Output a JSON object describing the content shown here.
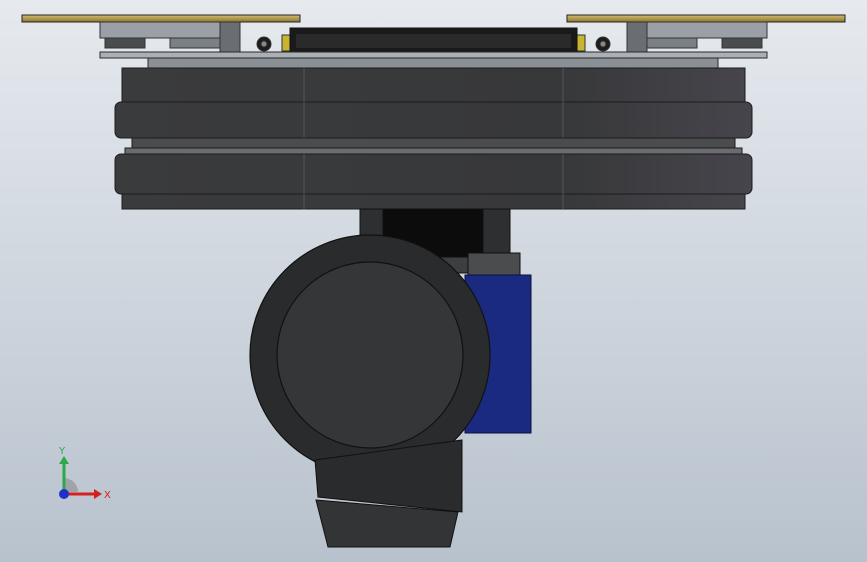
{
  "viewport": {
    "bg_top": "#e6eaef",
    "bg_bottom": "#b8c2cd"
  },
  "model": {
    "plate_color": "#b49a4e",
    "flange_color": "#3a3b3c",
    "dark_body": "#2a2b2c",
    "motor_color": "#1a2a80",
    "accent_yellow": "#c8b430"
  },
  "triad": {
    "y_label": "Y",
    "x_label": "X",
    "y_color": "#2ba84a",
    "x_color": "#d42020",
    "z_color": "#2030c8"
  }
}
